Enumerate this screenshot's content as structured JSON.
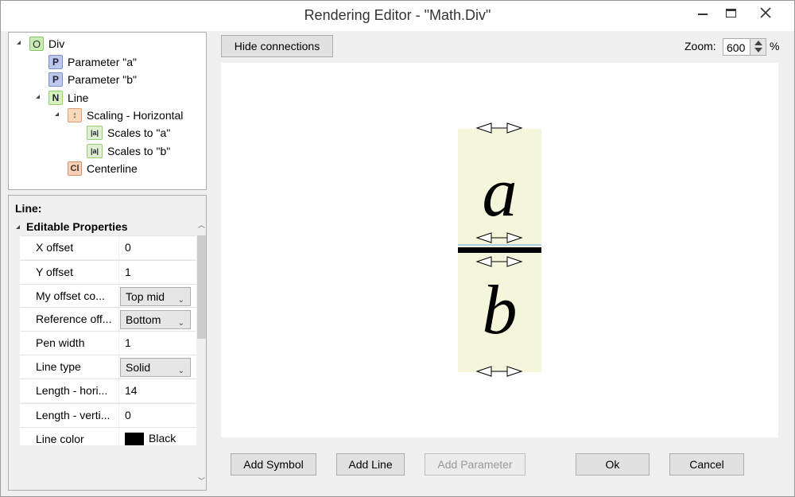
{
  "window": {
    "title": "Rendering Editor - \"Math.Div\""
  },
  "tree": {
    "items": [
      {
        "badge": "O",
        "label": "Div"
      },
      {
        "badge": "P",
        "label": "Parameter \"a\""
      },
      {
        "badge": "P",
        "label": "Parameter \"b\""
      },
      {
        "badge": "N",
        "label": "Line"
      },
      {
        "badge": "↕",
        "label": "Scaling - Horizontal"
      },
      {
        "badge": "|a|",
        "label": "Scales to \"a\""
      },
      {
        "badge": "|a|",
        "label": "Scales to \"b\""
      },
      {
        "badge": "Cl",
        "label": "Centerline"
      }
    ]
  },
  "properties": {
    "title": "Line:",
    "group": "Editable Properties",
    "rows": [
      {
        "name": "X offset",
        "value": "0"
      },
      {
        "name": "Y offset",
        "value": "1"
      },
      {
        "name": "My offset co...",
        "value": "Top mid"
      },
      {
        "name": "Reference off...",
        "value": "Bottom"
      },
      {
        "name": "Pen width",
        "value": "1"
      },
      {
        "name": "Line type",
        "value": "Solid"
      },
      {
        "name": "Length - hori...",
        "value": "14"
      },
      {
        "name": "Length - verti...",
        "value": "0"
      },
      {
        "name": "Line color",
        "value": "Black"
      }
    ]
  },
  "toolbar": {
    "hide_connections": "Hide connections",
    "zoom_label": "Zoom:",
    "zoom_value": "600",
    "zoom_unit": "%"
  },
  "canvas": {
    "numerator": "a",
    "denominator": "b",
    "symbol_bg": "#f5f5dc",
    "line_color": "#000000"
  },
  "buttons": {
    "add_symbol": "Add Symbol",
    "add_line": "Add Line",
    "add_parameter": "Add Parameter",
    "ok": "Ok",
    "cancel": "Cancel"
  }
}
